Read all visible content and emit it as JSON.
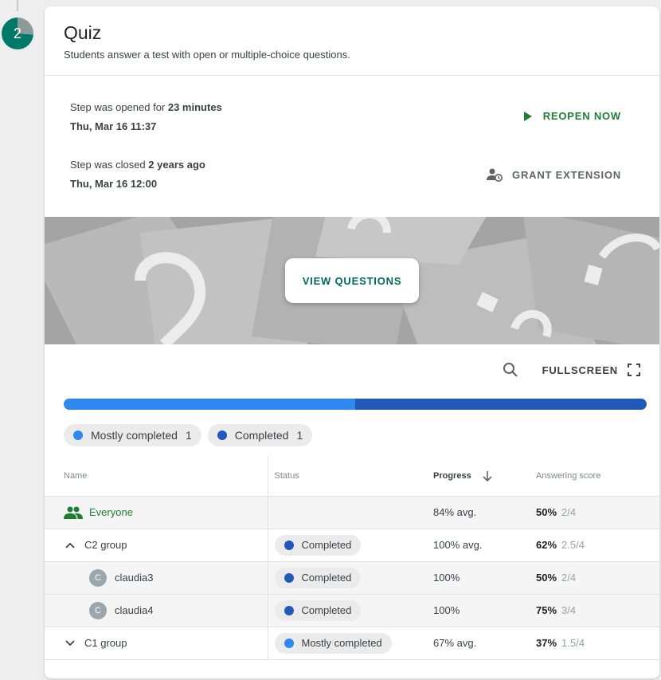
{
  "step": {
    "number": "2"
  },
  "card": {
    "title": "Quiz",
    "subtitle": "Students answer a test with open or multiple-choice questions."
  },
  "opened": {
    "prefix": "Step was opened for ",
    "duration": "23 minutes",
    "date": "Thu, Mar 16 11:37",
    "action_label": "Reopen now"
  },
  "closed": {
    "prefix": "Step was closed ",
    "ago": "2 years ago",
    "date": "Thu, Mar 16 12:00",
    "action_label": "Grant extension"
  },
  "banner": {
    "button_label": "VIEW QUESTIONS"
  },
  "toolbar": {
    "fullscreen_label": "FULLSCREEN"
  },
  "progress": {
    "segments": [
      {
        "label": "Mostly completed",
        "fraction": 0.5,
        "color": "#2d88f0"
      },
      {
        "label": "Completed",
        "fraction": 0.5,
        "color": "#2258b8"
      }
    ]
  },
  "chips": [
    {
      "label": "Mostly completed",
      "count": "1",
      "color": "#2d88f0"
    },
    {
      "label": "Completed",
      "count": "1",
      "color": "#2258b8"
    }
  ],
  "table": {
    "headers": {
      "name": "Name",
      "status": "Status",
      "progress": "Progress",
      "score": "Answering score"
    },
    "rows": [
      {
        "name": "Everyone",
        "status": "",
        "progress": "84% avg.",
        "score": "50%",
        "frac": "2/4"
      },
      {
        "name": "C2 group",
        "status": "Completed",
        "progress": "100% avg.",
        "score": "62%",
        "frac": "2.5/4"
      },
      {
        "name": "claudia3",
        "avatar": "C",
        "status": "Completed",
        "progress": "100%",
        "score": "50%",
        "frac": "2/4"
      },
      {
        "name": "claudia4",
        "avatar": "C",
        "status": "Completed",
        "progress": "100%",
        "score": "75%",
        "frac": "3/4"
      },
      {
        "name": "C1 group",
        "status": "Mostly completed",
        "progress": "67% avg.",
        "score": "37%",
        "frac": "1.5/4"
      }
    ]
  },
  "colors": {
    "accent": "#00796b",
    "green": "#1e7e34",
    "completed": "#2258b8",
    "mostly_completed": "#2d88f0"
  }
}
